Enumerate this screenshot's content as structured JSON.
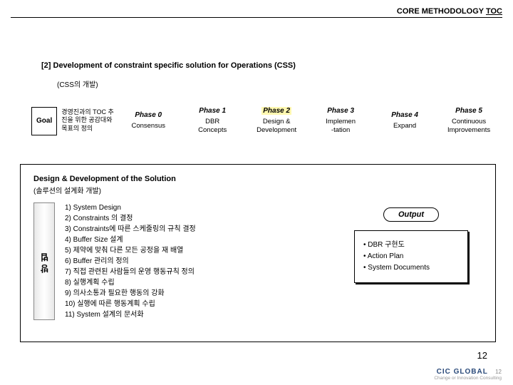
{
  "header": {
    "title": "CORE METHODOLOGY",
    "toc": "TOC"
  },
  "section": {
    "number_title": "[2] Development of constraint specific solution for Operations (CSS)",
    "subtitle": "(CSS의 개발)"
  },
  "goal": {
    "label": "Goal",
    "text": "경영진과의 TOC 추진을 위한 공감대와 목표의 정의"
  },
  "phases": [
    {
      "head": "Phase 0",
      "body": "Consensus",
      "highlight": false
    },
    {
      "head": "Phase 1",
      "body": "DBR\nConcepts",
      "highlight": false
    },
    {
      "head": "Phase 2",
      "body": "Design &\nDevelopment",
      "highlight": true
    },
    {
      "head": "Phase 3",
      "body": "Implemen\n-tation",
      "highlight": false
    },
    {
      "head": "Phase 4",
      "body": "Expand",
      "highlight": false
    },
    {
      "head": "Phase 5",
      "body": "Continuous\nImprovements",
      "highlight": false
    }
  ],
  "solution": {
    "title": "Design & Development of the Solution",
    "subtitle": "(솔루션의 설계화 개발)",
    "method_label": "방법",
    "steps": [
      "1) System Design",
      "2) Constraints 의 결정",
      "3) Constraints에 따른 스케줄링의 규칙 결정",
      "4) Buffer Size 설계",
      "5) 제약에 맞춰 다른 모든 공정을 재 배열",
      "6) Buffer 관리의 정의",
      "7) 직접 관련된 사람들의 운영 행동규칙 정의",
      "8) 실행계획 수립",
      "9) 의사소통과 필요한 행동의 강화",
      "10) 실행에 따른 행동계획 수립",
      "11) System 설계의 문서화"
    ]
  },
  "output": {
    "label": "Output",
    "items": [
      "DBR 구현도",
      "Action Plan",
      "System Documents"
    ]
  },
  "footer": {
    "page_big": "12",
    "logo": "CIC GLOBAL",
    "tagline": "Change or Innovation Consulting",
    "page_small": "12"
  }
}
